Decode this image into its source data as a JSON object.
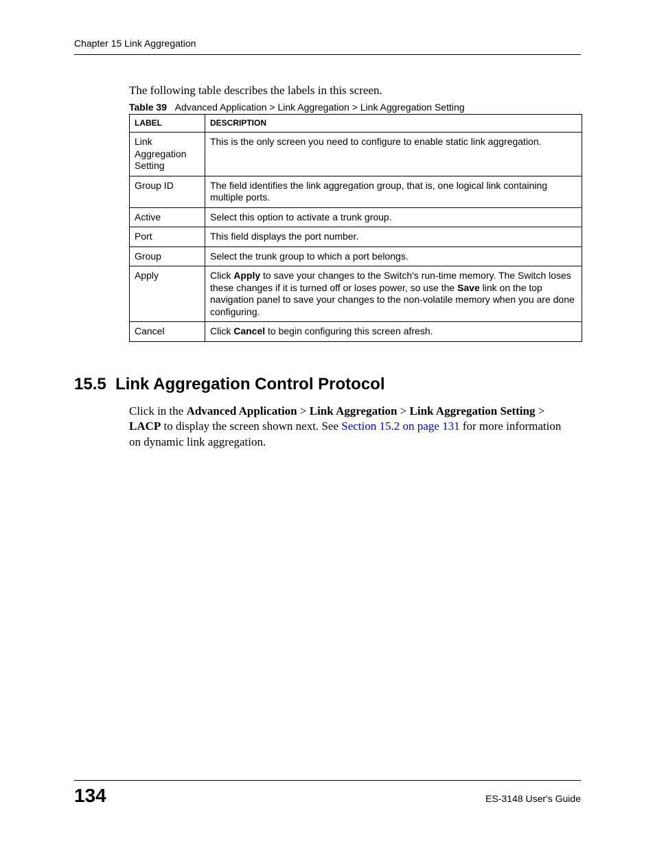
{
  "header": {
    "running_head": "Chapter 15 Link Aggregation"
  },
  "intro_text": "The following table describes the labels in this screen.",
  "table": {
    "caption_prefix": "Table 39",
    "caption_text": "Advanced Application > Link Aggregation > Link Aggregation Setting",
    "headers": {
      "label": "LABEL",
      "description": "DESCRIPTION"
    },
    "rows": [
      {
        "label": "Link Aggregation Setting",
        "desc": "This is the only screen you need to configure to enable static link aggregation."
      },
      {
        "label": "Group ID",
        "desc": "The field identifies the link aggregation group, that is, one logical link containing multiple ports."
      },
      {
        "label": "Active",
        "desc": "Select this option to activate a trunk group."
      },
      {
        "label": "Port",
        "desc": "This field displays the port number."
      },
      {
        "label": "Group",
        "desc": "Select the trunk group to which a port belongs."
      },
      {
        "label": "Apply",
        "desc_parts": {
          "p1": "Click ",
          "b1": "Apply",
          "p2": " to save your changes to the Switch's run-time memory. The Switch loses these changes if it is turned off or loses power, so use the ",
          "b2": "Save",
          "p3": " link on the top navigation panel to save your changes to the non-volatile memory when you are done configuring."
        }
      },
      {
        "label": "Cancel",
        "desc_parts": {
          "p1": "Click ",
          "b1": "Cancel",
          "p2": " to begin configuring this screen afresh."
        }
      }
    ]
  },
  "section": {
    "number": "15.5",
    "title": "Link Aggregation Control Protocol",
    "para": {
      "p1": "Click in the ",
      "b1": "Advanced Application",
      "gt1": " > ",
      "b2": "Link Aggregation",
      "gt2": " > ",
      "b3": "Link Aggregation Setting",
      "gt3": " > ",
      "b4": "LACP",
      "p2": " to display the screen shown next. See ",
      "xref": "Section 15.2 on page 131",
      "p3": " for more information on dynamic link aggregation."
    }
  },
  "footer": {
    "page_number": "134",
    "guide": "ES-3148 User's Guide"
  }
}
